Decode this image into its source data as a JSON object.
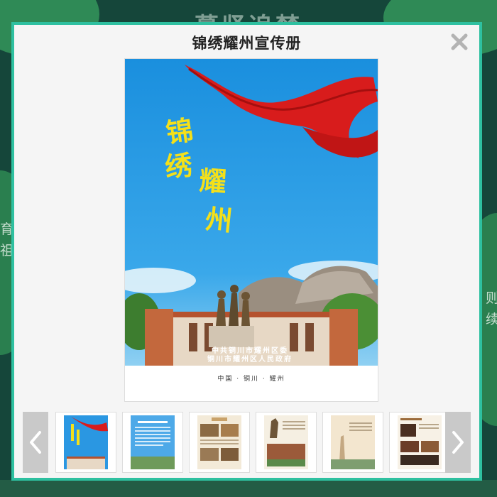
{
  "background": {
    "title": "慕贤追梦",
    "side_left": "育\n祖",
    "side_right": "则\n续"
  },
  "modal": {
    "title": "锦绣耀州宣传册",
    "close_icon": "close-icon",
    "accent": "#2ec0a0"
  },
  "cover": {
    "calligraphy_1": "锦",
    "calligraphy_2": "绣",
    "calligraphy_3": "耀",
    "calligraphy_4": "州",
    "publisher_1": "中共铜川市耀州区委",
    "publisher_2": "铜川市耀州区人民政府",
    "footer": "中国 · 铜川 · 耀州"
  },
  "thumbnails": {
    "prev_icon": "chevron-left-icon",
    "next_icon": "chevron-right-icon",
    "items": [
      {
        "name": "cover",
        "selected": true
      },
      {
        "name": "page-2"
      },
      {
        "name": "page-3"
      },
      {
        "name": "page-4"
      },
      {
        "name": "page-5"
      },
      {
        "name": "page-6"
      }
    ]
  }
}
